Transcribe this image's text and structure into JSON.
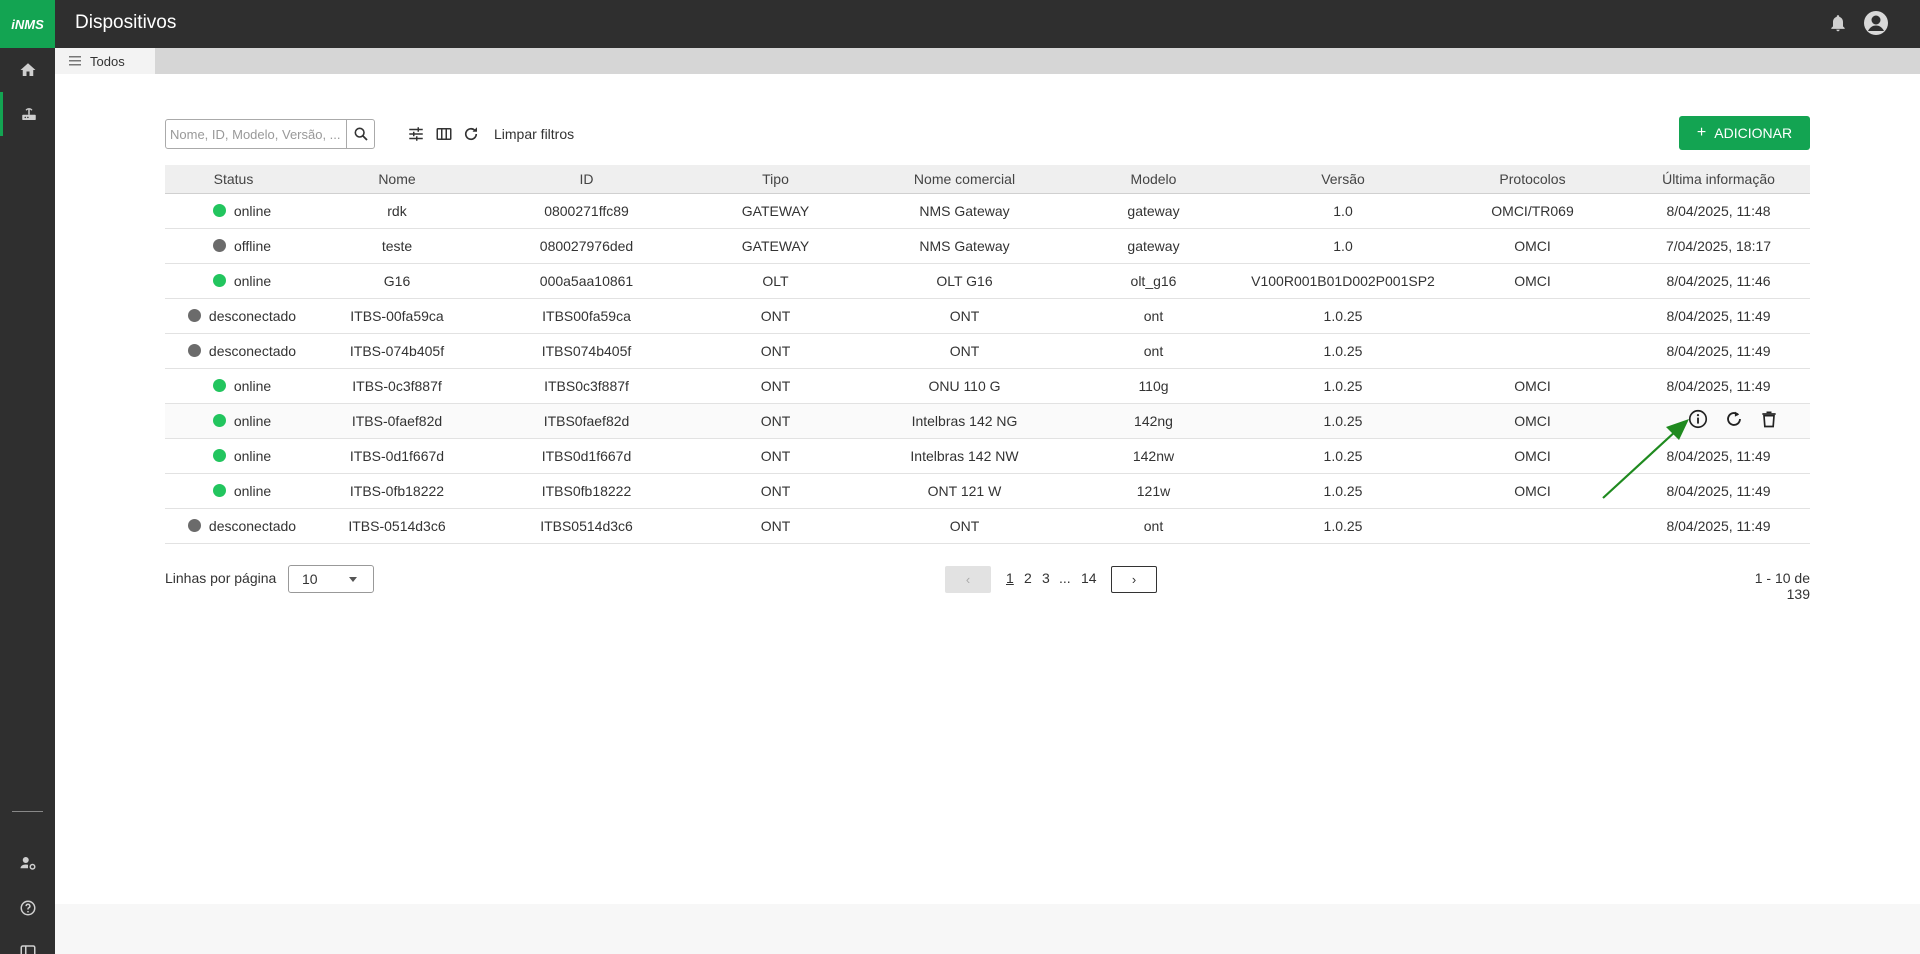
{
  "app": {
    "logo": "iNMS",
    "title": "Dispositivos"
  },
  "tabs": [
    {
      "label": "Todos"
    }
  ],
  "toolbar": {
    "search_placeholder": "Nome, ID, Modelo, Versão, ...",
    "clear_filters": "Limpar filtros",
    "add_label": "ADICIONAR",
    "add_plus": "+"
  },
  "table": {
    "headers": [
      "Status",
      "Nome",
      "ID",
      "Tipo",
      "Nome comercial",
      "Modelo",
      "Versão",
      "Protocolos",
      "Última informação"
    ],
    "rows": [
      {
        "status": "online",
        "status_color": "#22c55e",
        "nome": "rdk",
        "id": "0800271ffc89",
        "tipo": "GATEWAY",
        "comercial": "NMS Gateway",
        "modelo": "gateway",
        "versao": "1.0",
        "protocolos": "OMCI/TR069",
        "ultima": "8/04/2025, 11:48"
      },
      {
        "status": "offline",
        "status_color": "#6b6b6b",
        "nome": "teste",
        "id": "080027976ded",
        "tipo": "GATEWAY",
        "comercial": "NMS Gateway",
        "modelo": "gateway",
        "versao": "1.0",
        "protocolos": "OMCI",
        "ultima": "7/04/2025, 18:17"
      },
      {
        "status": "online",
        "status_color": "#22c55e",
        "nome": "G16",
        "id": "000a5aa10861",
        "tipo": "OLT",
        "comercial": "OLT G16",
        "modelo": "olt_g16",
        "versao": "V100R001B01D002P001SP2",
        "protocolos": "OMCI",
        "ultima": "8/04/2025, 11:46"
      },
      {
        "status": "desconectado",
        "status_color": "#6b6b6b",
        "nome": "ITBS-00fa59ca",
        "id": "ITBS00fa59ca",
        "tipo": "ONT",
        "comercial": "ONT",
        "modelo": "ont",
        "versao": "1.0.25",
        "protocolos": "",
        "ultima": "8/04/2025, 11:49"
      },
      {
        "status": "desconectado",
        "status_color": "#6b6b6b",
        "nome": "ITBS-074b405f",
        "id": "ITBS074b405f",
        "tipo": "ONT",
        "comercial": "ONT",
        "modelo": "ont",
        "versao": "1.0.25",
        "protocolos": "",
        "ultima": "8/04/2025, 11:49"
      },
      {
        "status": "online",
        "status_color": "#22c55e",
        "nome": "ITBS-0c3f887f",
        "id": "ITBS0c3f887f",
        "tipo": "ONT",
        "comercial": "ONU 110 G",
        "modelo": "110g",
        "versao": "1.0.25",
        "protocolos": "OMCI",
        "ultima": "8/04/2025, 11:49"
      },
      {
        "status": "online",
        "status_color": "#22c55e",
        "nome": "ITBS-0faef82d",
        "id": "ITBS0faef82d",
        "tipo": "ONT",
        "comercial": "Intelbras 142 NG",
        "modelo": "142ng",
        "versao": "1.0.25",
        "protocolos": "OMCI",
        "ultima": ""
      },
      {
        "status": "online",
        "status_color": "#22c55e",
        "nome": "ITBS-0d1f667d",
        "id": "ITBS0d1f667d",
        "tipo": "ONT",
        "comercial": "Intelbras 142 NW",
        "modelo": "142nw",
        "versao": "1.0.25",
        "protocolos": "OMCI",
        "ultima": "8/04/2025, 11:49"
      },
      {
        "status": "online",
        "status_color": "#22c55e",
        "nome": "ITBS-0fb18222",
        "id": "ITBS0fb18222",
        "tipo": "ONT",
        "comercial": "ONT 121 W",
        "modelo": "121w",
        "versao": "1.0.25",
        "protocolos": "OMCI",
        "ultima": "8/04/2025, 11:49"
      },
      {
        "status": "desconectado",
        "status_color": "#6b6b6b",
        "nome": "ITBS-0514d3c6",
        "id": "ITBS0514d3c6",
        "tipo": "ONT",
        "comercial": "ONT",
        "modelo": "ont",
        "versao": "1.0.25",
        "protocolos": "",
        "ultima": "8/04/2025, 11:49"
      }
    ],
    "row_actions": [
      "info-icon",
      "refresh-icon",
      "trash-icon"
    ]
  },
  "pagination": {
    "rows_label": "Linhas por página",
    "rows_value": "10",
    "prev": "‹",
    "next": "›",
    "pages": [
      "1",
      "2",
      "3",
      "...",
      "14"
    ],
    "current_page": "1",
    "range": "1 - 10 de 139"
  },
  "sidebar": {
    "items": [
      {
        "icon": "home-icon"
      },
      {
        "icon": "router-icon"
      },
      {
        "icon": "user-settings-icon"
      },
      {
        "icon": "help-icon"
      },
      {
        "icon": "collapse-sidebar-icon"
      }
    ]
  },
  "colors": {
    "brand": "#13a452",
    "online": "#22c55e",
    "offline": "#6b6b6b",
    "annotation": "#1f8a1f"
  }
}
